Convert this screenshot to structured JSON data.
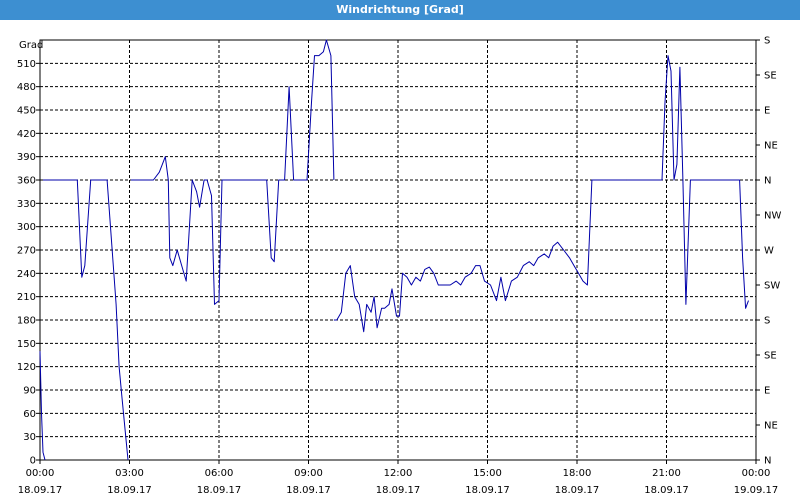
{
  "window": {
    "title": "Windrichtung [Grad]"
  },
  "chart_data": {
    "type": "line",
    "title": "Windrichtung [Grad]",
    "ylabel": "Grad",
    "ylim": [
      0,
      540
    ],
    "y_ticks": [
      0,
      30,
      60,
      90,
      120,
      150,
      180,
      210,
      240,
      270,
      300,
      330,
      360,
      390,
      420,
      450,
      480,
      510
    ],
    "right_axis": {
      "values": [
        0,
        45,
        90,
        135,
        180,
        225,
        270,
        315,
        360,
        405,
        450,
        495,
        540
      ],
      "labels": [
        "N",
        "NE",
        "E",
        "SE",
        "S",
        "SW",
        "W",
        "NW",
        "N",
        "NE",
        "E",
        "SE",
        "S"
      ]
    },
    "x_unit": "hours since 18.09.17 00:00",
    "xlim": [
      0,
      24
    ],
    "x_ticks": [
      {
        "x": 0,
        "time": "00:00",
        "date": "18.09.17"
      },
      {
        "x": 3,
        "time": "03:00",
        "date": "18.09.17"
      },
      {
        "x": 6,
        "time": "06:00",
        "date": "18.09.17"
      },
      {
        "x": 9,
        "time": "09:00",
        "date": "18.09.17"
      },
      {
        "x": 12,
        "time": "12:00",
        "date": "18.09.17"
      },
      {
        "x": 15,
        "time": "15:00",
        "date": "18.09.17"
      },
      {
        "x": 18,
        "time": "18:00",
        "date": "18.09.17"
      },
      {
        "x": 21,
        "time": "21:00",
        "date": "18.09.17"
      },
      {
        "x": 24,
        "time": "00:00",
        "date": "19.09.17"
      }
    ],
    "grid": true,
    "colors": {
      "line": "#0000aa",
      "grid": "#000000",
      "title_bar": "#3d8fd1"
    },
    "series": [
      {
        "name": "",
        "segments": [
          {
            "x": [
              0.0,
              0.05,
              0.1,
              0.167
            ],
            "y": [
              140,
              60,
              10,
              0
            ]
          },
          {
            "x": [
              0.1,
              0.3,
              0.5,
              0.7,
              0.9,
              1.1,
              1.25,
              1.4,
              1.5,
              1.7,
              1.85,
              2.0,
              2.15,
              2.25,
              2.4,
              2.55,
              2.65,
              2.75,
              2.85,
              2.95
            ],
            "y": [
              360,
              360,
              360,
              360,
              360,
              360,
              360,
              235,
              250,
              360,
              360,
              360,
              360,
              360,
              280,
              200,
              120,
              80,
              40,
              0
            ]
          },
          {
            "x": [
              3.05,
              3.3,
              3.55,
              3.8,
              4.0,
              4.1,
              4.2,
              4.3,
              4.35,
              4.45,
              4.6,
              4.75,
              4.9,
              5.1,
              5.25,
              5.35,
              5.5,
              5.6,
              5.75,
              5.85,
              6.0,
              6.1,
              6.2,
              6.4,
              6.6,
              6.8,
              7.0,
              7.2,
              7.4,
              7.6,
              7.75,
              7.85,
              8.0,
              8.1,
              8.2,
              8.35,
              8.5,
              8.6,
              8.8,
              8.95,
              9.1,
              9.2,
              9.35,
              9.5,
              9.6,
              9.75,
              9.85
            ],
            "y": [
              360,
              360,
              360,
              360,
              370,
              380,
              390,
              360,
              260,
              250,
              270,
              250,
              230,
              360,
              345,
              325,
              360,
              360,
              340,
              200,
              205,
              360,
              360,
              360,
              360,
              360,
              360,
              360,
              360,
              360,
              260,
              255,
              360,
              360,
              360,
              480,
              360,
              360,
              360,
              360,
              460,
              520,
              520,
              525,
              540,
              520,
              360
            ]
          },
          {
            "x": [
              9.85,
              9.95,
              10.1,
              10.25,
              10.4,
              10.55,
              10.7,
              10.85,
              10.95,
              11.1,
              11.2,
              11.3,
              11.45,
              11.55,
              11.7,
              11.8,
              11.95,
              12.05,
              12.15,
              12.3,
              12.45,
              12.6,
              12.75,
              12.9,
              13.05,
              13.2,
              13.35,
              13.55,
              13.75,
              13.95,
              14.1,
              14.25,
              14.45,
              14.6,
              14.75,
              14.9,
              15.1,
              15.3,
              15.45,
              15.6,
              15.8,
              16.0,
              16.2,
              16.4,
              16.55,
              16.7,
              16.9,
              17.05,
              17.2,
              17.35,
              17.55,
              17.75,
              17.9,
              18.05,
              18.2,
              18.35,
              18.5,
              18.65,
              18.8,
              18.95,
              19.1,
              19.25,
              19.4,
              19.55,
              19.65
            ],
            "y": [
              180,
              180,
              190,
              240,
              250,
              210,
              200,
              165,
              200,
              190,
              210,
              170,
              195,
              195,
              200,
              220,
              185,
              185,
              240,
              235,
              225,
              235,
              230,
              245,
              248,
              240,
              225,
              225,
              225,
              230,
              225,
              235,
              240,
              250,
              250,
              230,
              225,
              205,
              235,
              205,
              230,
              235,
              250,
              255,
              250,
              260,
              265,
              260,
              275,
              280,
              270,
              260,
              250,
              240,
              230,
              225,
              360,
              360,
              360,
              360,
              360,
              360,
              360,
              360,
              360
            ]
          },
          {
            "x": [
              19.65,
              19.9,
              20.1,
              20.3,
              20.5,
              20.7,
              20.85,
              20.95,
              21.05,
              21.15,
              21.25,
              21.35,
              21.45,
              21.55,
              21.65,
              21.8,
              21.95,
              22.1,
              22.25,
              22.4,
              22.55,
              22.7,
              22.85,
              23.0,
              23.15,
              23.3,
              23.45,
              23.55,
              23.65,
              23.75
            ],
            "y": [
              360,
              360,
              360,
              360,
              360,
              360,
              360,
              460,
              520,
              500,
              360,
              380,
              505,
              360,
              200,
              360,
              360,
              360,
              360,
              360,
              360,
              360,
              360,
              360,
              360,
              360,
              360,
              260,
              195,
              205
            ]
          }
        ]
      }
    ]
  }
}
